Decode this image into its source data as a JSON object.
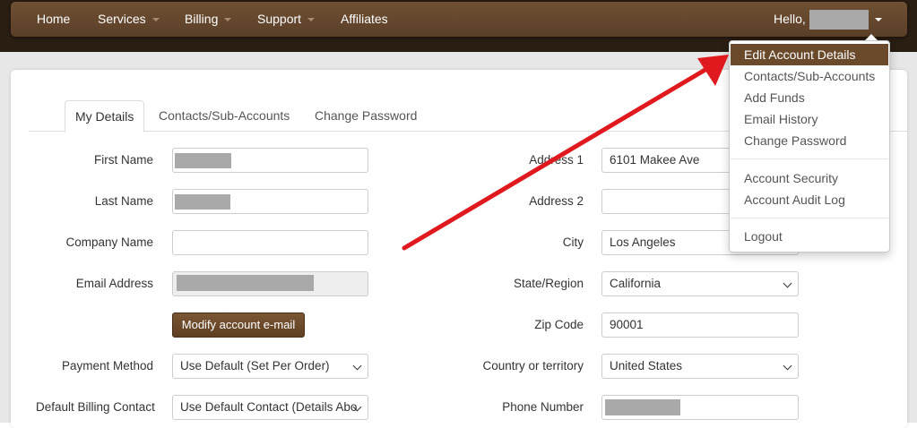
{
  "navbar": {
    "items": [
      {
        "label": "Home",
        "has_caret": false
      },
      {
        "label": "Services",
        "has_caret": true
      },
      {
        "label": "Billing",
        "has_caret": true
      },
      {
        "label": "Support",
        "has_caret": true
      },
      {
        "label": "Affiliates",
        "has_caret": false
      }
    ],
    "greeting": "Hello,",
    "username_redacted": true
  },
  "tabs": [
    {
      "label": "My Details",
      "active": true
    },
    {
      "label": "Contacts/Sub-Accounts",
      "active": false
    },
    {
      "label": "Change Password",
      "active": false
    }
  ],
  "form": {
    "first_name": {
      "label": "First Name",
      "value_redacted": true
    },
    "last_name": {
      "label": "Last Name",
      "value_redacted": true
    },
    "company_name": {
      "label": "Company Name",
      "value": ""
    },
    "email": {
      "label": "Email Address",
      "value_redacted": true
    },
    "modify_email_button": "Modify account e-mail",
    "payment_method": {
      "label": "Payment Method",
      "value": "Use Default (Set Per Order)"
    },
    "default_billing_contact": {
      "label": "Default Billing Contact",
      "value": "Use Default Contact (Details Abo"
    },
    "address1": {
      "label": "Address 1",
      "value": "6101 Makee Ave"
    },
    "address2": {
      "label": "Address 2",
      "value": ""
    },
    "city": {
      "label": "City",
      "value": "Los Angeles"
    },
    "state": {
      "label": "State/Region",
      "value": "California"
    },
    "zip": {
      "label": "Zip Code",
      "value": "90001"
    },
    "country": {
      "label": "Country or territory",
      "value": "United States"
    },
    "phone": {
      "label": "Phone Number",
      "value_redacted": true
    }
  },
  "account_menu": {
    "items": [
      {
        "label": "Edit Account Details",
        "active": true
      },
      {
        "label": "Contacts/Sub-Accounts"
      },
      {
        "label": "Add Funds"
      },
      {
        "label": "Email History"
      },
      {
        "label": "Change Password"
      },
      {
        "label": "Account Security"
      },
      {
        "label": "Account Audit Log"
      },
      {
        "label": "Logout"
      }
    ]
  },
  "colors": {
    "navbar": "#5f432a",
    "accent": "#6b4a2c",
    "annotation_arrow": "#e0191e"
  }
}
